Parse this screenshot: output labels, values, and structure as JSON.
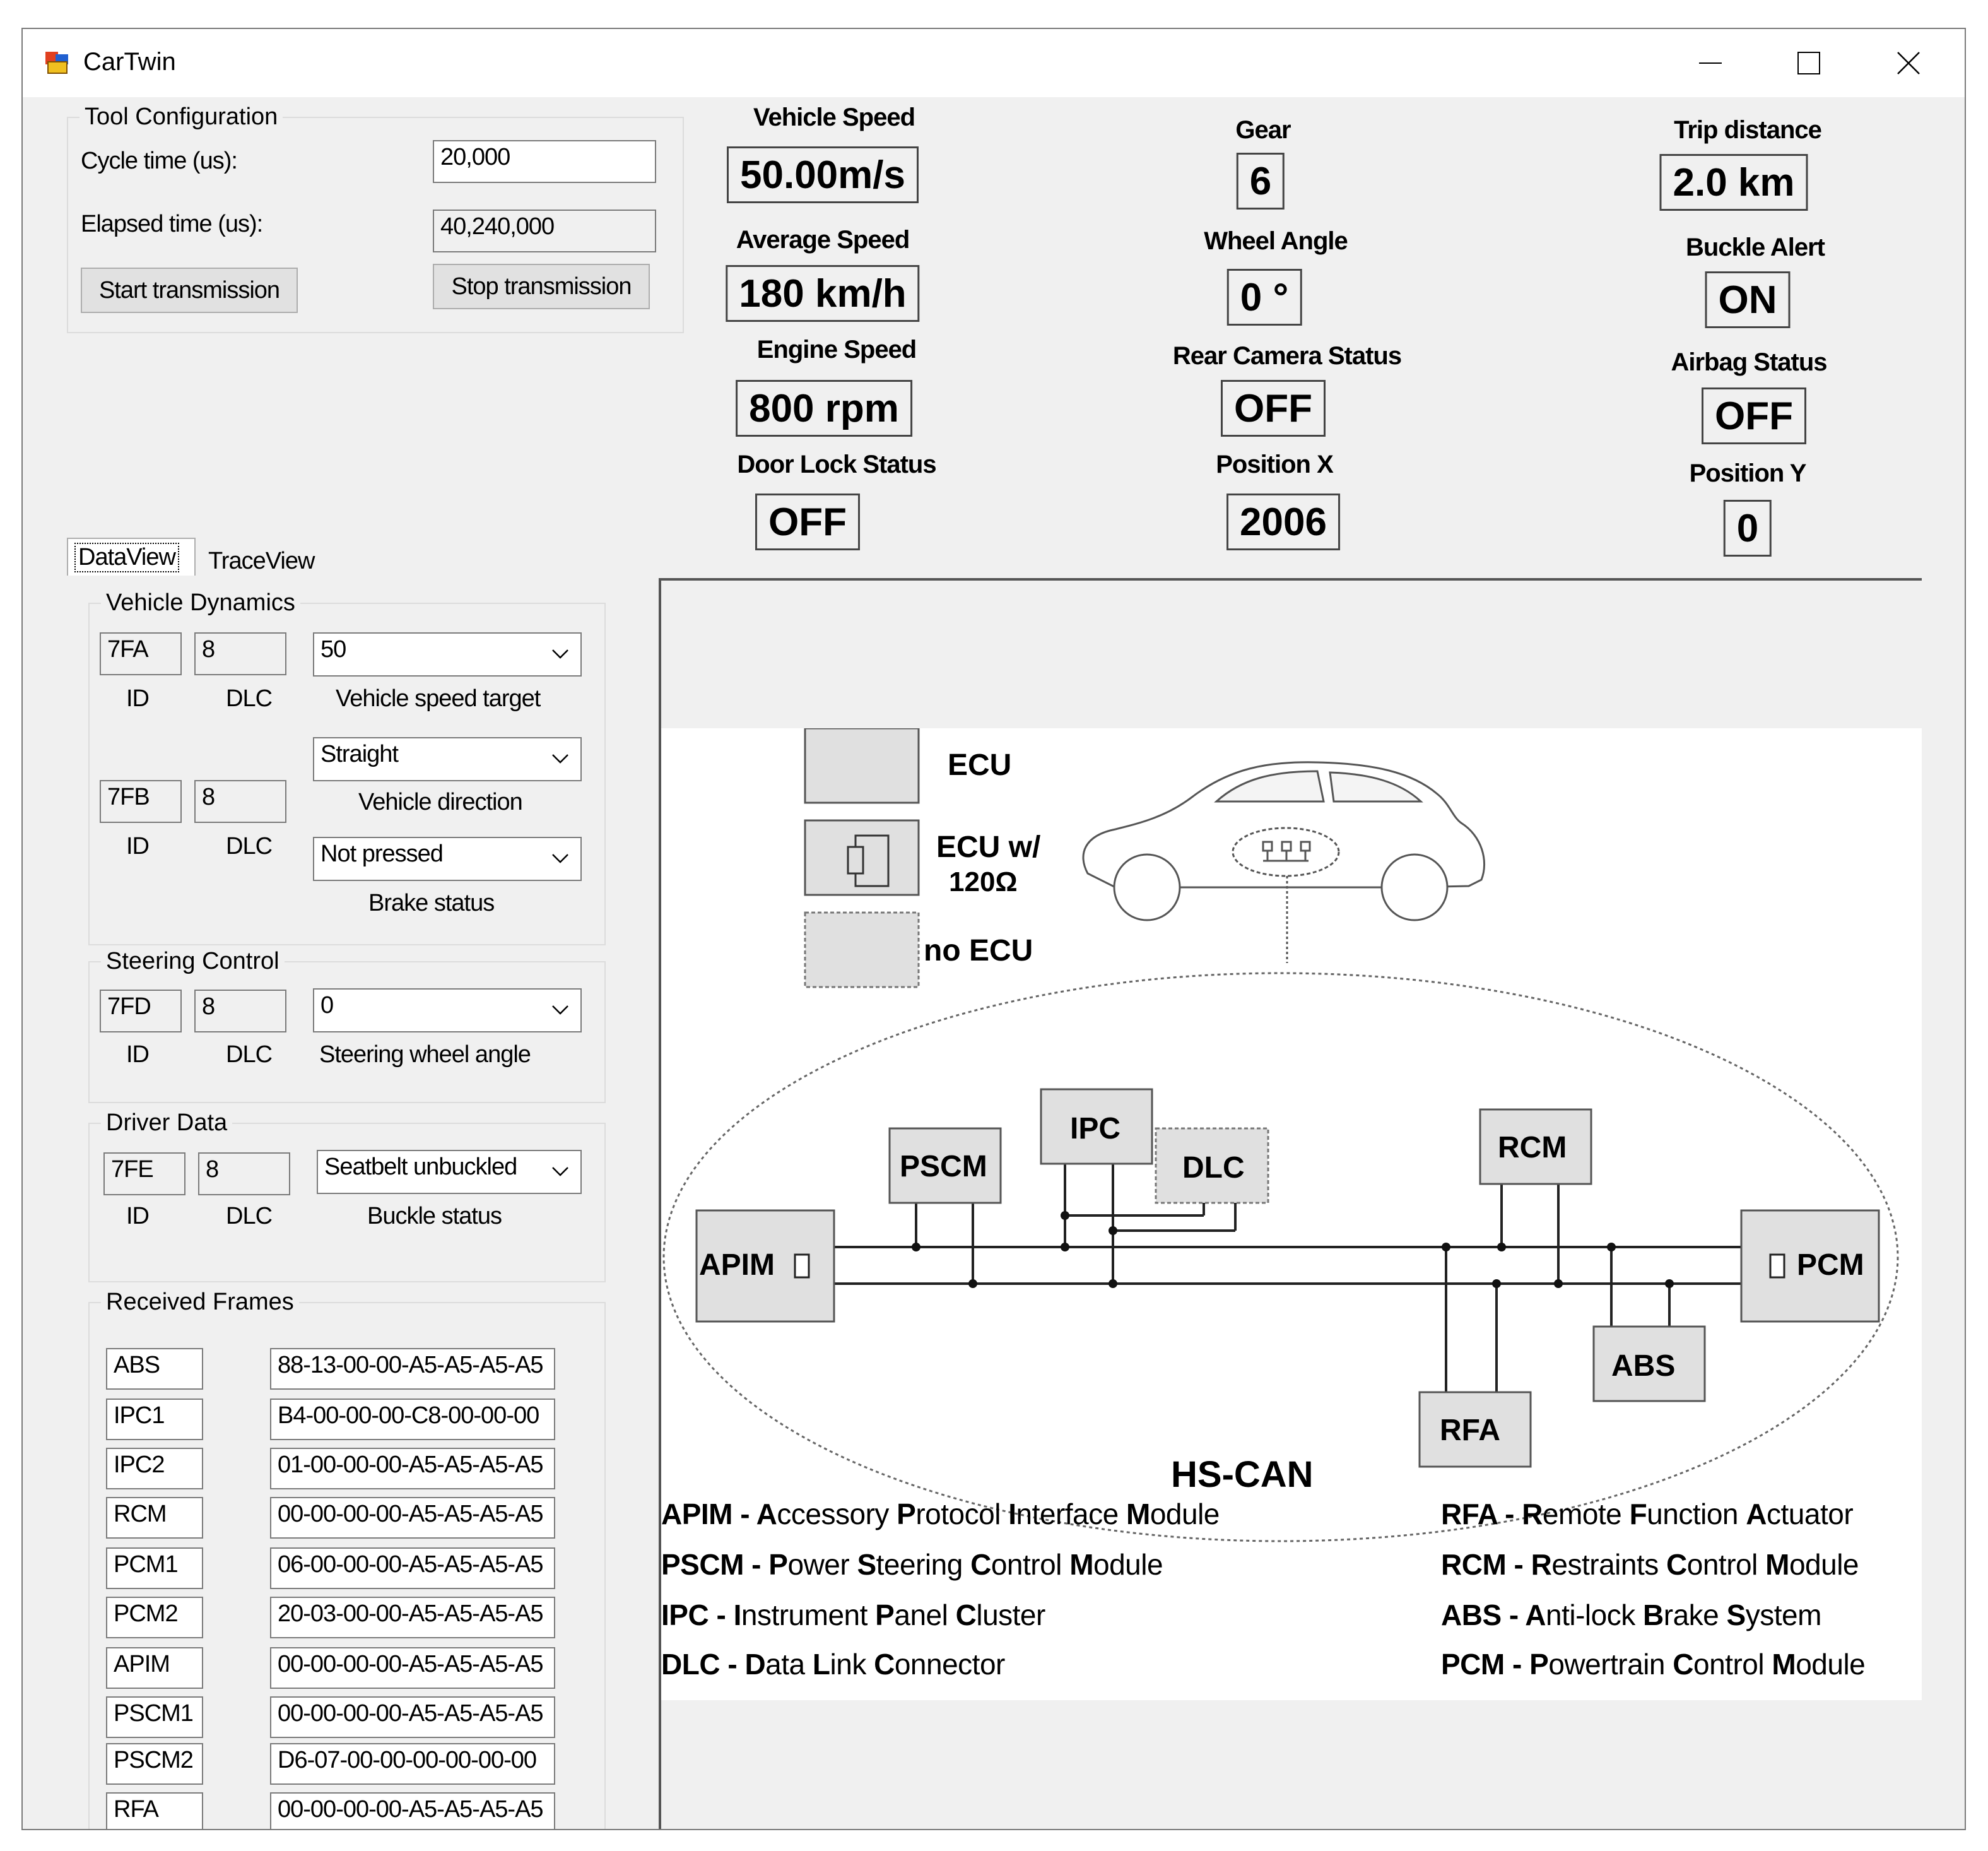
{
  "window": {
    "title": "CarTwin",
    "controls": {
      "minimize": "minimize",
      "maximize": "maximize",
      "close": "close"
    }
  },
  "tool_config": {
    "legend": "Tool Configuration",
    "cycle_label": "Cycle time (us):",
    "cycle_value": "20,000",
    "elapsed_label": "Elapsed time (us):",
    "elapsed_value": "40,240,000",
    "start_button": "Start transmission",
    "stop_button": "Stop transmission"
  },
  "indicators": {
    "vehicle_speed": {
      "label": "Vehicle Speed",
      "value": "50.00m/s"
    },
    "average_speed": {
      "label": "Average Speed",
      "value": "180 km/h"
    },
    "engine_speed": {
      "label": "Engine Speed",
      "value": "800 rpm"
    },
    "door_lock": {
      "label": "Door Lock Status",
      "value": "OFF"
    },
    "gear": {
      "label": "Gear",
      "value": "6"
    },
    "wheel_angle": {
      "label": "Wheel Angle",
      "value": "0 °"
    },
    "rear_camera": {
      "label": "Rear Camera Status",
      "value": "OFF"
    },
    "position_x": {
      "label": "Position X",
      "value": "2006"
    },
    "trip_distance": {
      "label": "Trip distance",
      "value": "2.0 km"
    },
    "buckle_alert": {
      "label": "Buckle Alert",
      "value": "ON"
    },
    "airbag_status": {
      "label": "Airbag Status",
      "value": "OFF"
    },
    "position_y": {
      "label": "Position Y",
      "value": "0"
    }
  },
  "tabs": [
    {
      "label": "DataView",
      "selected": true
    },
    {
      "label": "TraceView",
      "selected": false
    }
  ],
  "vehicle_dynamics": {
    "legend": "Vehicle Dynamics",
    "row1": {
      "id": "7FA",
      "dlc": "8",
      "combo": "50",
      "combo_label": "Vehicle speed target"
    },
    "row2": {
      "id": "7FB",
      "dlc": "8",
      "combo_a": "Straight",
      "combo_a_label": "Vehicle direction",
      "combo_b": "Not pressed",
      "combo_b_label": "Brake status"
    },
    "id_label": "ID",
    "dlc_label": "DLC"
  },
  "steering_control": {
    "legend": "Steering Control",
    "id": "7FD",
    "dlc": "8",
    "combo": "0",
    "combo_label": "Steering wheel angle",
    "id_label": "ID",
    "dlc_label": "DLC"
  },
  "driver_data": {
    "legend": "Driver Data",
    "id": "7FE",
    "dlc": "8",
    "combo": "Seatbelt unbuckled",
    "combo_label": "Buckle status",
    "id_label": "ID",
    "dlc_label": "DLC"
  },
  "received_frames": {
    "legend": "Received Frames",
    "rows": [
      {
        "name": "ABS",
        "data": "88-13-00-00-A5-A5-A5-A5"
      },
      {
        "name": "IPC1",
        "data": "B4-00-00-00-C8-00-00-00"
      },
      {
        "name": "IPC2",
        "data": "01-00-00-00-A5-A5-A5-A5"
      },
      {
        "name": "RCM",
        "data": "00-00-00-00-A5-A5-A5-A5"
      },
      {
        "name": "PCM1",
        "data": "06-00-00-00-A5-A5-A5-A5"
      },
      {
        "name": "PCM2",
        "data": "20-03-00-00-A5-A5-A5-A5"
      },
      {
        "name": "APIM",
        "data": "00-00-00-00-A5-A5-A5-A5"
      },
      {
        "name": "PSCM1",
        "data": "00-00-00-00-A5-A5-A5-A5"
      },
      {
        "name": "PSCM2",
        "data": "D6-07-00-00-00-00-00-00"
      },
      {
        "name": "RFA",
        "data": "00-00-00-00-A5-A5-A5-A5"
      }
    ]
  },
  "diagram": {
    "key": {
      "ecu": "ECU",
      "ecu_term_line1": "ECU w/",
      "ecu_term_line2": "120Ω",
      "no_ecu": "no ECU"
    },
    "nodes": {
      "apim": "APIM",
      "pscm": "PSCM",
      "ipc": "IPC",
      "dlc": "DLC",
      "rcm": "RCM",
      "pcm": "PCM",
      "abs": "ABS",
      "rfa": "RFA"
    },
    "bus_label": "HS-CAN",
    "legend_left": [
      {
        "abbr": "APIM",
        "desc": [
          [
            "A",
            "ccessory "
          ],
          [
            "P",
            "rotocol "
          ],
          [
            "I",
            "nterface "
          ],
          [
            "M",
            "odule"
          ]
        ]
      },
      {
        "abbr": "PSCM",
        "desc": [
          [
            "P",
            "ower "
          ],
          [
            "S",
            "teering "
          ],
          [
            "C",
            "ontrol "
          ],
          [
            "M",
            "odule"
          ]
        ]
      },
      {
        "abbr": "IPC",
        "desc": [
          [
            "I",
            "nstrument "
          ],
          [
            "P",
            "anel "
          ],
          [
            "C",
            "luster"
          ]
        ]
      },
      {
        "abbr": "DLC",
        "desc": [
          [
            "D",
            "ata "
          ],
          [
            "L",
            "ink "
          ],
          [
            "C",
            "onnector"
          ]
        ]
      }
    ],
    "legend_right": [
      {
        "abbr": "RFA",
        "desc": [
          [
            "R",
            "emote "
          ],
          [
            "F",
            "unction "
          ],
          [
            "A",
            "ctuator"
          ]
        ]
      },
      {
        "abbr": "RCM",
        "desc": [
          [
            "R",
            "estraints "
          ],
          [
            "C",
            "ontrol "
          ],
          [
            "M",
            "odule"
          ]
        ]
      },
      {
        "abbr": "ABS",
        "desc": [
          [
            "A",
            "nti-lock "
          ],
          [
            "B",
            "rake "
          ],
          [
            "S",
            "ystem"
          ]
        ]
      },
      {
        "abbr": "PCM",
        "desc": [
          [
            "P",
            "owertrain "
          ],
          [
            "C",
            "ontrol "
          ],
          [
            "M",
            "odule"
          ]
        ]
      }
    ]
  }
}
